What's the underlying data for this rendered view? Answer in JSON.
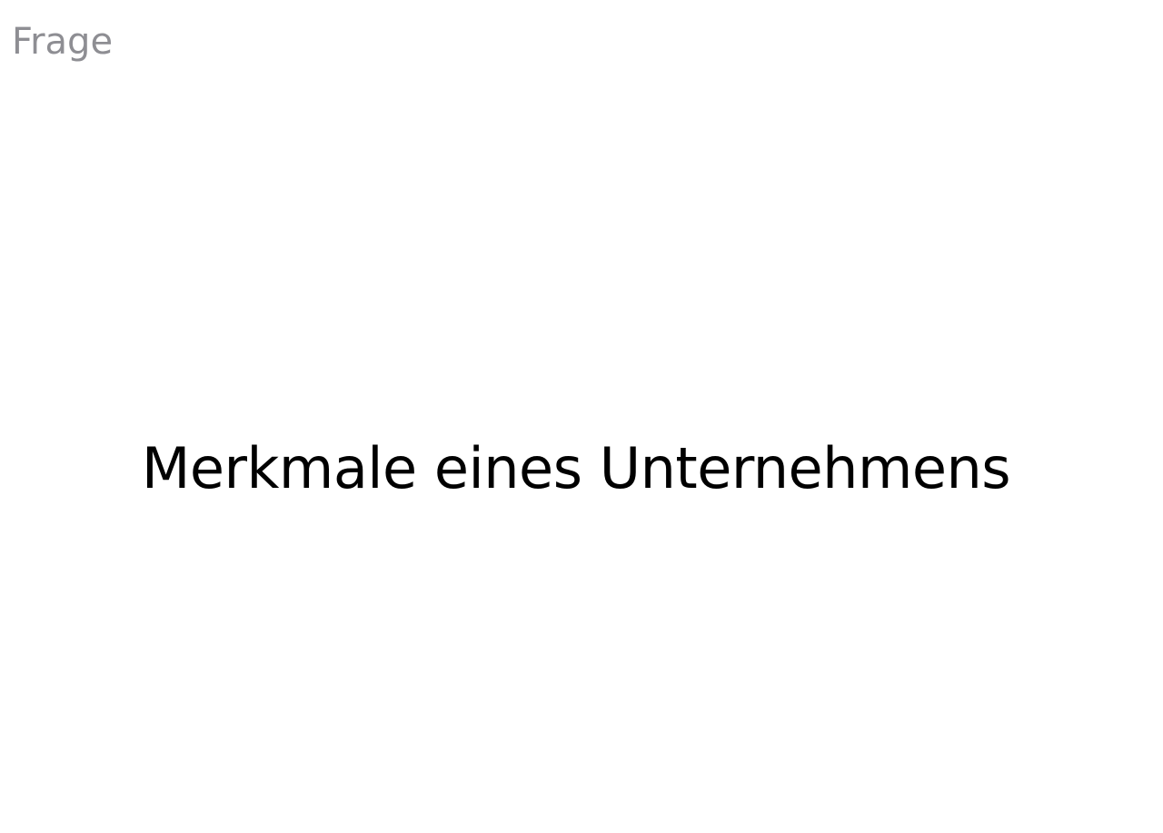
{
  "card": {
    "label": "Frage",
    "question": "Merkmale eines Unternehmens"
  },
  "colors": {
    "background": "#ffffff",
    "label": "#8e8e93",
    "text": "#000000"
  }
}
